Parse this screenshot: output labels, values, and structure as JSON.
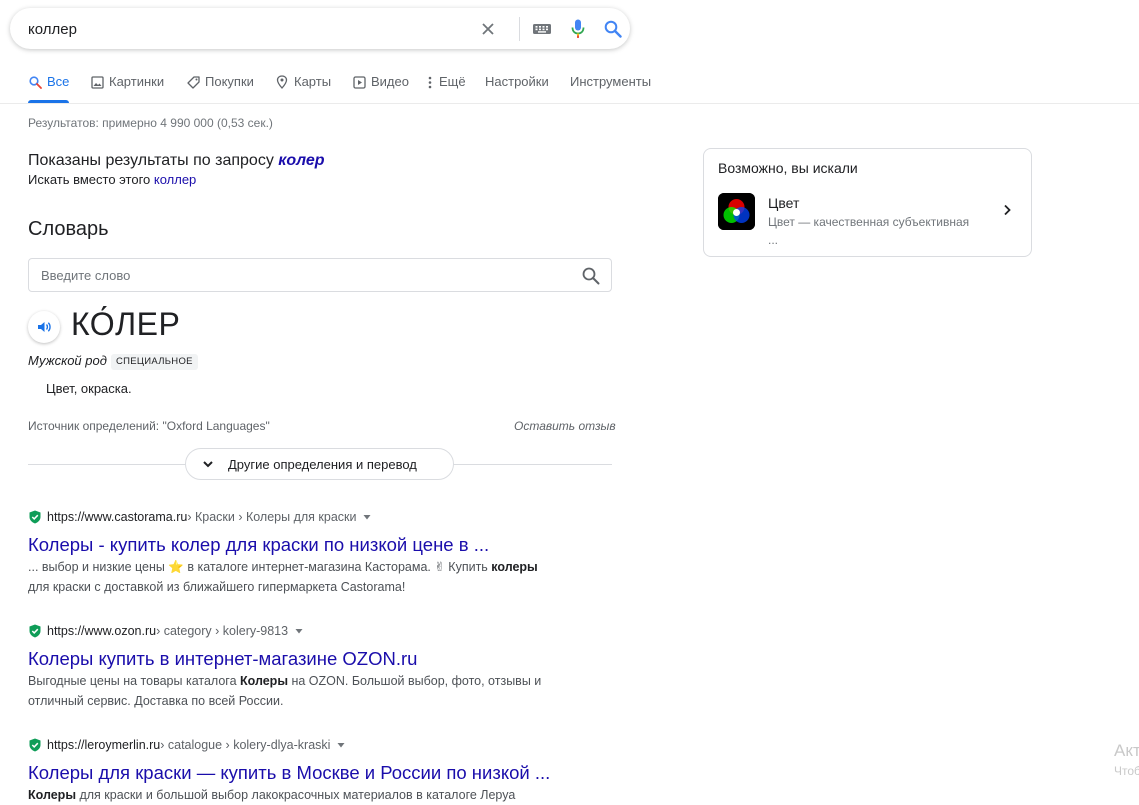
{
  "search": {
    "query": "коллер"
  },
  "tabs": [
    {
      "label": "Все",
      "icon": "search-icon"
    },
    {
      "label": "Картинки",
      "icon": "image-icon"
    },
    {
      "label": "Покупки",
      "icon": "tag-icon"
    },
    {
      "label": "Карты",
      "icon": "map-pin-icon"
    },
    {
      "label": "Видео",
      "icon": "play-icon"
    },
    {
      "label": "Ещё",
      "icon": "more-vert-icon"
    },
    {
      "label": "Настройки"
    },
    {
      "label": "Инструменты"
    }
  ],
  "stats": "Результатов: примерно 4 990 000 (0,53 сек.)",
  "correction": {
    "showing_prefix": "Показаны результаты по запросу",
    "corrected_query": "колер",
    "instead_prefix": "Искать вместо этого",
    "original_query": "коллер"
  },
  "dictionary": {
    "title": "Словарь",
    "placeholder": "Введите слово",
    "headword": "КО́ЛЕР",
    "part_of_speech": "Мужской род",
    "badge": "СПЕЦИАЛЬНОЕ",
    "definition": "Цвет, окраска.",
    "source": "Источник определений: \"Oxford Languages\"",
    "feedback": "Оставить отзыв",
    "more_button": "Другие определения и перевод"
  },
  "results": [
    {
      "domain": "https://www.castorama.ru",
      "breadcrumbs": " › Краски › Колеры для краски",
      "title": "Колеры - купить колер для краски по низкой цене в ...",
      "snippet_html": "... выбор и низкие цены ⭐ в каталоге интернет-магазина Касторама. ✌ Купить <b>колеры</b><br>для краски с доставкой из ближайшего гипермаркета Castorama!"
    },
    {
      "domain": "https://www.ozon.ru",
      "breadcrumbs": " › category › kolery-9813",
      "title": "Колеры купить в интернет-магазине OZON.ru",
      "snippet_html": "Выгодные цены на товары каталога <b>Колеры</b> на OZON. Большой выбор, фото, отзывы и<br>отличный сервис. Доставка по всей России."
    },
    {
      "domain": "https://leroymerlin.ru",
      "breadcrumbs": " › catalogue › kolery-dlya-kraski",
      "title": "Колеры для краски — купить в Москве и России по низкой ...",
      "snippet_html": "<b>Колеры</b> для краски и большой выбор лакокрасочных материалов в каталоге Леруа"
    }
  ],
  "side_panel": {
    "title": "Возможно, вы искали",
    "item_name": "Цвет",
    "item_desc": "Цвет — качественная субъективная",
    "item_ellipsis": "..."
  },
  "watermark": {
    "line1": "Акт",
    "line2": "Чтоб"
  },
  "colors": {
    "link": "#1a0dab",
    "accent": "#1a73e8",
    "secure": "#0f9d58"
  }
}
